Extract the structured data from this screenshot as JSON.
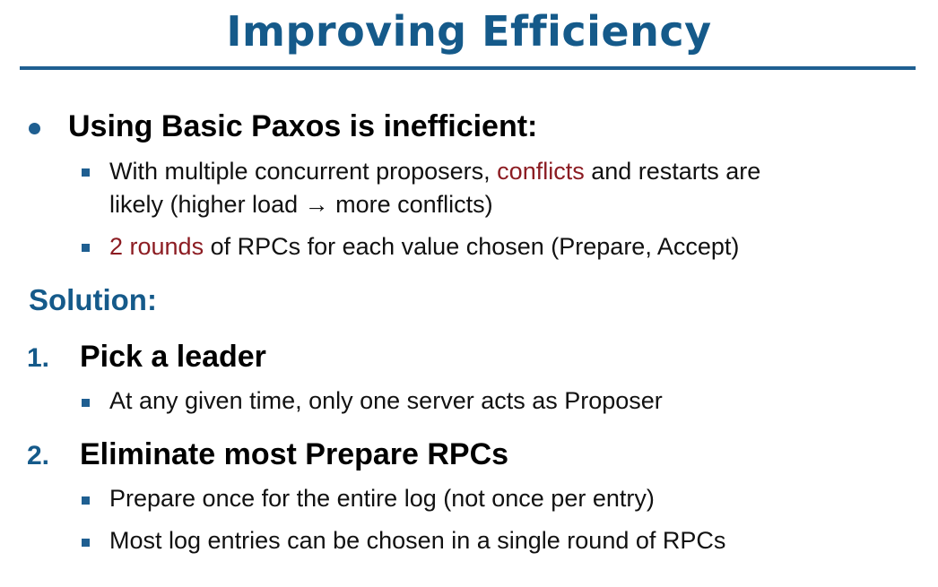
{
  "slide": {
    "title": "Improving Efficiency",
    "colors": {
      "title": "#155a8a",
      "bullet": "#1f5f91",
      "highlight": "#8c1c22"
    },
    "heading1": "Using Basic Paxos is inefficient:",
    "sub1": {
      "before": "With multiple concurrent proposers, ",
      "highlight": "conflicts",
      "after": " and restarts are",
      "line2": "likely (higher load → more conflicts)"
    },
    "sub2": {
      "highlight": "2 rounds",
      "after": " of RPCs for each value chosen (Prepare, Accept)"
    },
    "solution_label": "Solution:",
    "steps": [
      {
        "number": "1.",
        "heading": "Pick a leader",
        "bullets": [
          "At any given time, only one server acts as Proposer"
        ]
      },
      {
        "number": "2.",
        "heading": "Eliminate most Prepare RPCs",
        "bullets": [
          "Prepare once for the entire log (not once per entry)",
          "Most log entries can be chosen in a single round of RPCs"
        ]
      }
    ]
  }
}
